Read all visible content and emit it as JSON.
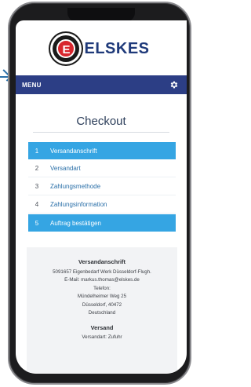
{
  "header": {
    "brand_initial": "E",
    "brand_name": "ELSKES",
    "menu_label": "MENU",
    "settings_icon": "gear-icon"
  },
  "page_title": "Checkout",
  "steps": [
    {
      "number": "1",
      "label": "Versandanschrift",
      "active": true
    },
    {
      "number": "2",
      "label": "Versandart",
      "active": false
    },
    {
      "number": "3",
      "label": "Zahlungsmethode",
      "active": false
    },
    {
      "number": "4",
      "label": "Zahlungsinformation",
      "active": false
    },
    {
      "number": "5",
      "label": "Auftrag bestätigen",
      "active": true
    }
  ],
  "summary": {
    "address_heading": "Versandanschrift",
    "address_lines": [
      "5091657 Eigenbedarf Werk Düsseldorf-Flugh.",
      "E-Mail: markus.thomas@elskes.de",
      "Telefon:",
      "Mündelheimer Weg 25",
      "Düsseldorf, 40472",
      "Deutschland"
    ],
    "shipping_heading": "Versand",
    "shipping_line": "Versandart: Zufuhr"
  },
  "colors": {
    "brand_blue": "#2c3e85",
    "step_active": "#35a5e3",
    "logo_red": "#d8262e"
  }
}
